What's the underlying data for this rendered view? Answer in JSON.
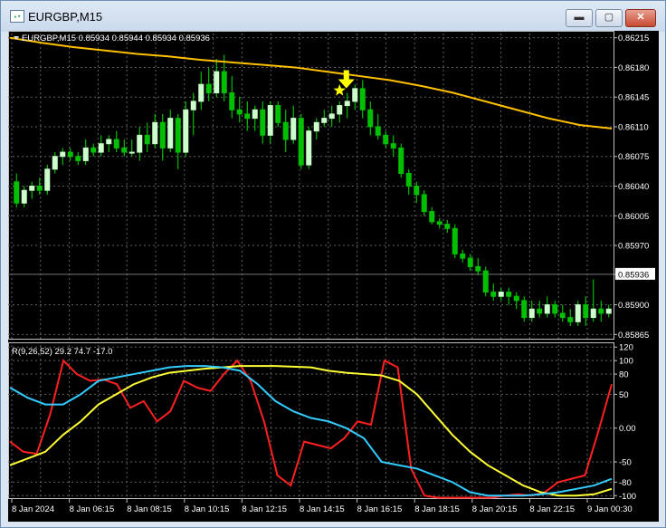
{
  "window": {
    "title": "EURGBP,M15",
    "icon_name": "chart-window-icon",
    "minimize_label": "▬",
    "maximize_label": "▢",
    "close_label": "✕"
  },
  "header": {
    "symbol_info": "EURGBP,M15  0.85934 0.85944 0.85934 0.85936",
    "menu_icon": "triangle-down-icon"
  },
  "indicator": {
    "label": "R(9,26,52) 29.2 74.7 -17.0"
  },
  "colors": {
    "background": "#000000",
    "bull": "#ccffcc",
    "bear": "#00c000",
    "wick": "#00e000",
    "ma": "#ffc000",
    "red": "#ff2020",
    "yellow": "#ffff33",
    "cyan": "#33ccff",
    "arrow": "#ffff00",
    "grid": "#606060"
  },
  "markers": {
    "arrow_icon": "arrow-down-icon",
    "star_icon": "star-icon"
  },
  "chart_data": [
    {
      "type": "candlestick",
      "title": "EURGBP,M15",
      "price_axis_ticks": [
        "0.86215",
        "0.86180",
        "0.86145",
        "0.86110",
        "0.86075",
        "0.86040",
        "0.86005",
        "0.85970",
        "0.85936",
        "0.85900",
        "0.85865"
      ],
      "current_price": "0.85936",
      "ylim": [
        0.8586,
        0.8622
      ],
      "x_tick_labels": [
        "8 Jan 2024",
        "8 Jan 06:15",
        "8 Jan 08:15",
        "8 Jan 10:15",
        "8 Jan 12:15",
        "8 Jan 14:15",
        "8 Jan 16:15",
        "8 Jan 18:15",
        "8 Jan 20:15",
        "8 Jan 22:15",
        "9 Jan 00:30"
      ],
      "candles": [
        [
          0.86045,
          0.86055,
          0.86015,
          0.8602
        ],
        [
          0.8602,
          0.8604,
          0.86015,
          0.86035
        ],
        [
          0.86035,
          0.86045,
          0.86025,
          0.8604
        ],
        [
          0.8604,
          0.8605,
          0.8603,
          0.86035
        ],
        [
          0.86035,
          0.86065,
          0.8603,
          0.8606
        ],
        [
          0.8606,
          0.8608,
          0.86055,
          0.86075
        ],
        [
          0.86075,
          0.86085,
          0.86065,
          0.8608
        ],
        [
          0.8608,
          0.86085,
          0.8607,
          0.86075
        ],
        [
          0.86075,
          0.8608,
          0.86065,
          0.8607
        ],
        [
          0.8607,
          0.86095,
          0.86065,
          0.86085
        ],
        [
          0.86085,
          0.8609,
          0.86075,
          0.8608
        ],
        [
          0.8608,
          0.861,
          0.86075,
          0.8609
        ],
        [
          0.8609,
          0.861,
          0.8608,
          0.86095
        ],
        [
          0.86095,
          0.86105,
          0.8608,
          0.86085
        ],
        [
          0.86085,
          0.86095,
          0.86075,
          0.8608
        ],
        [
          0.8608,
          0.86095,
          0.86075,
          0.8608
        ],
        [
          0.8608,
          0.8611,
          0.8607,
          0.861
        ],
        [
          0.861,
          0.86115,
          0.8608,
          0.8609
        ],
        [
          0.8609,
          0.86125,
          0.86085,
          0.86115
        ],
        [
          0.86115,
          0.86125,
          0.8607,
          0.86085
        ],
        [
          0.86085,
          0.8613,
          0.8608,
          0.8612
        ],
        [
          0.8612,
          0.86125,
          0.8606,
          0.8608
        ],
        [
          0.8608,
          0.8614,
          0.86075,
          0.8613
        ],
        [
          0.8613,
          0.8615,
          0.861,
          0.8614
        ],
        [
          0.8614,
          0.86175,
          0.8613,
          0.8616
        ],
        [
          0.8616,
          0.8618,
          0.8614,
          0.8615
        ],
        [
          0.8615,
          0.8619,
          0.86145,
          0.86175
        ],
        [
          0.86175,
          0.86195,
          0.8614,
          0.8615
        ],
        [
          0.8615,
          0.8617,
          0.8612,
          0.8613
        ],
        [
          0.8613,
          0.86145,
          0.86115,
          0.86125
        ],
        [
          0.86125,
          0.8614,
          0.86105,
          0.8612
        ],
        [
          0.8612,
          0.86135,
          0.86105,
          0.8613
        ],
        [
          0.8613,
          0.8614,
          0.8609,
          0.861
        ],
        [
          0.861,
          0.8614,
          0.8609,
          0.86135
        ],
        [
          0.86135,
          0.8614,
          0.8611,
          0.86115
        ],
        [
          0.86115,
          0.8613,
          0.8608,
          0.86095
        ],
        [
          0.86095,
          0.86135,
          0.8609,
          0.8612
        ],
        [
          0.8612,
          0.86125,
          0.8606,
          0.86065
        ],
        [
          0.86065,
          0.8611,
          0.8606,
          0.86105
        ],
        [
          0.86105,
          0.8612,
          0.86095,
          0.86115
        ],
        [
          0.86115,
          0.8613,
          0.8611,
          0.8612
        ],
        [
          0.8612,
          0.86135,
          0.8611,
          0.86125
        ],
        [
          0.86125,
          0.8614,
          0.86115,
          0.86135
        ],
        [
          0.86135,
          0.8615,
          0.8612,
          0.8614
        ],
        [
          0.8614,
          0.8616,
          0.8613,
          0.86155
        ],
        [
          0.86155,
          0.86165,
          0.8612,
          0.8613
        ],
        [
          0.8613,
          0.8614,
          0.861,
          0.8611
        ],
        [
          0.8611,
          0.86125,
          0.86095,
          0.861
        ],
        [
          0.861,
          0.86105,
          0.86085,
          0.8609
        ],
        [
          0.8609,
          0.861,
          0.86075,
          0.86085
        ],
        [
          0.86085,
          0.8609,
          0.8605,
          0.86055
        ],
        [
          0.86055,
          0.8606,
          0.8603,
          0.8604
        ],
        [
          0.8604,
          0.86045,
          0.8602,
          0.8603
        ],
        [
          0.8603,
          0.86035,
          0.86005,
          0.8601
        ],
        [
          0.8601,
          0.86015,
          0.85995,
          0.85998
        ],
        [
          0.85998,
          0.86002,
          0.8599,
          0.85995
        ],
        [
          0.85995,
          0.86,
          0.85985,
          0.8599
        ],
        [
          0.8599,
          0.85995,
          0.85955,
          0.8596
        ],
        [
          0.8596,
          0.85965,
          0.8595,
          0.85955
        ],
        [
          0.85955,
          0.8596,
          0.8594,
          0.85945
        ],
        [
          0.85945,
          0.85955,
          0.85935,
          0.8594
        ],
        [
          0.8594,
          0.85945,
          0.8591,
          0.85915
        ],
        [
          0.85915,
          0.85925,
          0.85905,
          0.8591
        ],
        [
          0.8591,
          0.8592,
          0.85905,
          0.85915
        ],
        [
          0.85915,
          0.8592,
          0.859,
          0.8591
        ],
        [
          0.8591,
          0.85915,
          0.85895,
          0.85905
        ],
        [
          0.85905,
          0.8591,
          0.8588,
          0.85885
        ],
        [
          0.85885,
          0.85905,
          0.8588,
          0.85895
        ],
        [
          0.85895,
          0.85905,
          0.85885,
          0.8589
        ],
        [
          0.8589,
          0.8591,
          0.85885,
          0.859
        ],
        [
          0.859,
          0.85905,
          0.85885,
          0.8589
        ],
        [
          0.8589,
          0.859,
          0.8588,
          0.85885
        ],
        [
          0.85885,
          0.85895,
          0.85875,
          0.8588
        ],
        [
          0.8588,
          0.85905,
          0.85875,
          0.859
        ],
        [
          0.859,
          0.8591,
          0.85875,
          0.85885
        ],
        [
          0.85885,
          0.8593,
          0.8588,
          0.85895
        ],
        [
          0.85895,
          0.85905,
          0.8588,
          0.8589
        ],
        [
          0.8589,
          0.859,
          0.85885,
          0.85895
        ]
      ],
      "ma": [
        0.86215,
        0.86209,
        0.86204,
        0.862,
        0.86196,
        0.86193,
        0.86189,
        0.86186,
        0.86183,
        0.8618,
        0.86175,
        0.8617,
        0.86165,
        0.86158,
        0.8615,
        0.8614,
        0.8613,
        0.8612,
        0.86112,
        0.86108
      ],
      "annotations": {
        "arrow_candle_index": 43,
        "star_candle_index": 42
      }
    },
    {
      "type": "line",
      "title": "",
      "y_ticks": [
        "120",
        "100",
        "80",
        "50",
        "0.00",
        "-50",
        "-80",
        "-100"
      ],
      "y_tick_values": [
        120,
        100,
        80,
        50,
        0,
        -50,
        -80,
        -100
      ],
      "ylim": [
        -105,
        123
      ],
      "series": [
        {
          "color": "red",
          "values": [
            -20,
            -35,
            -38,
            20,
            100,
            80,
            70,
            72,
            65,
            30,
            40,
            10,
            25,
            70,
            60,
            55,
            80,
            100,
            70,
            10,
            -70,
            -85,
            -20,
            -25,
            -30,
            -15,
            10,
            5,
            100,
            90,
            -60,
            -100,
            -103,
            -103,
            -103,
            -103,
            -103,
            -100,
            -98,
            -100,
            -95,
            -80,
            -75,
            -70,
            -5,
            65
          ]
        },
        {
          "color": "yellow",
          "values": [
            -55,
            -45,
            -35,
            -10,
            10,
            35,
            50,
            65,
            75,
            82,
            85,
            88,
            90,
            92,
            92,
            92,
            91,
            90,
            85,
            82,
            80,
            78,
            70,
            50,
            20,
            -10,
            -35,
            -55,
            -70,
            -85,
            -95,
            -100,
            -100,
            -98,
            -90
          ]
        },
        {
          "color": "cyan",
          "values": [
            60,
            45,
            35,
            35,
            50,
            70,
            75,
            80,
            85,
            90,
            92,
            92,
            90,
            85,
            65,
            40,
            25,
            15,
            10,
            0,
            -15,
            -50,
            -55,
            -60,
            -70,
            -80,
            -95,
            -100,
            -100,
            -100,
            -98,
            -95,
            -90,
            -85,
            -75
          ]
        }
      ]
    }
  ]
}
